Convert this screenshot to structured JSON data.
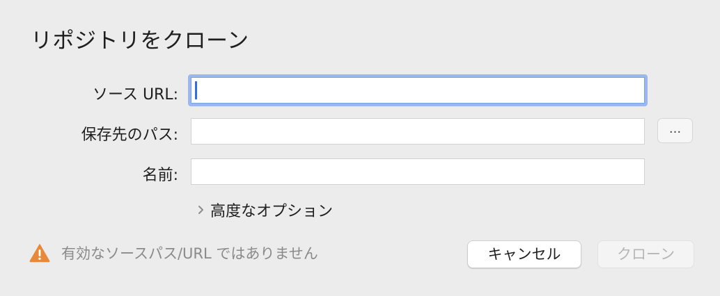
{
  "dialog": {
    "title": "リポジトリをクローン"
  },
  "form": {
    "source_url": {
      "label": "ソース URL:",
      "value": ""
    },
    "save_path": {
      "label": "保存先のパス:",
      "value": "",
      "browse_label": "..."
    },
    "name": {
      "label": "名前:",
      "value": ""
    },
    "advanced_options_label": "高度なオプション"
  },
  "status": {
    "warning_text": "有効なソースパス/URL ではありません",
    "warning_color": "#e8893a"
  },
  "buttons": {
    "cancel_label": "キャンセル",
    "clone_label": "クローン",
    "clone_enabled": false
  },
  "colors": {
    "focus_ring": "#9bb7ef",
    "background": "#ececec"
  }
}
